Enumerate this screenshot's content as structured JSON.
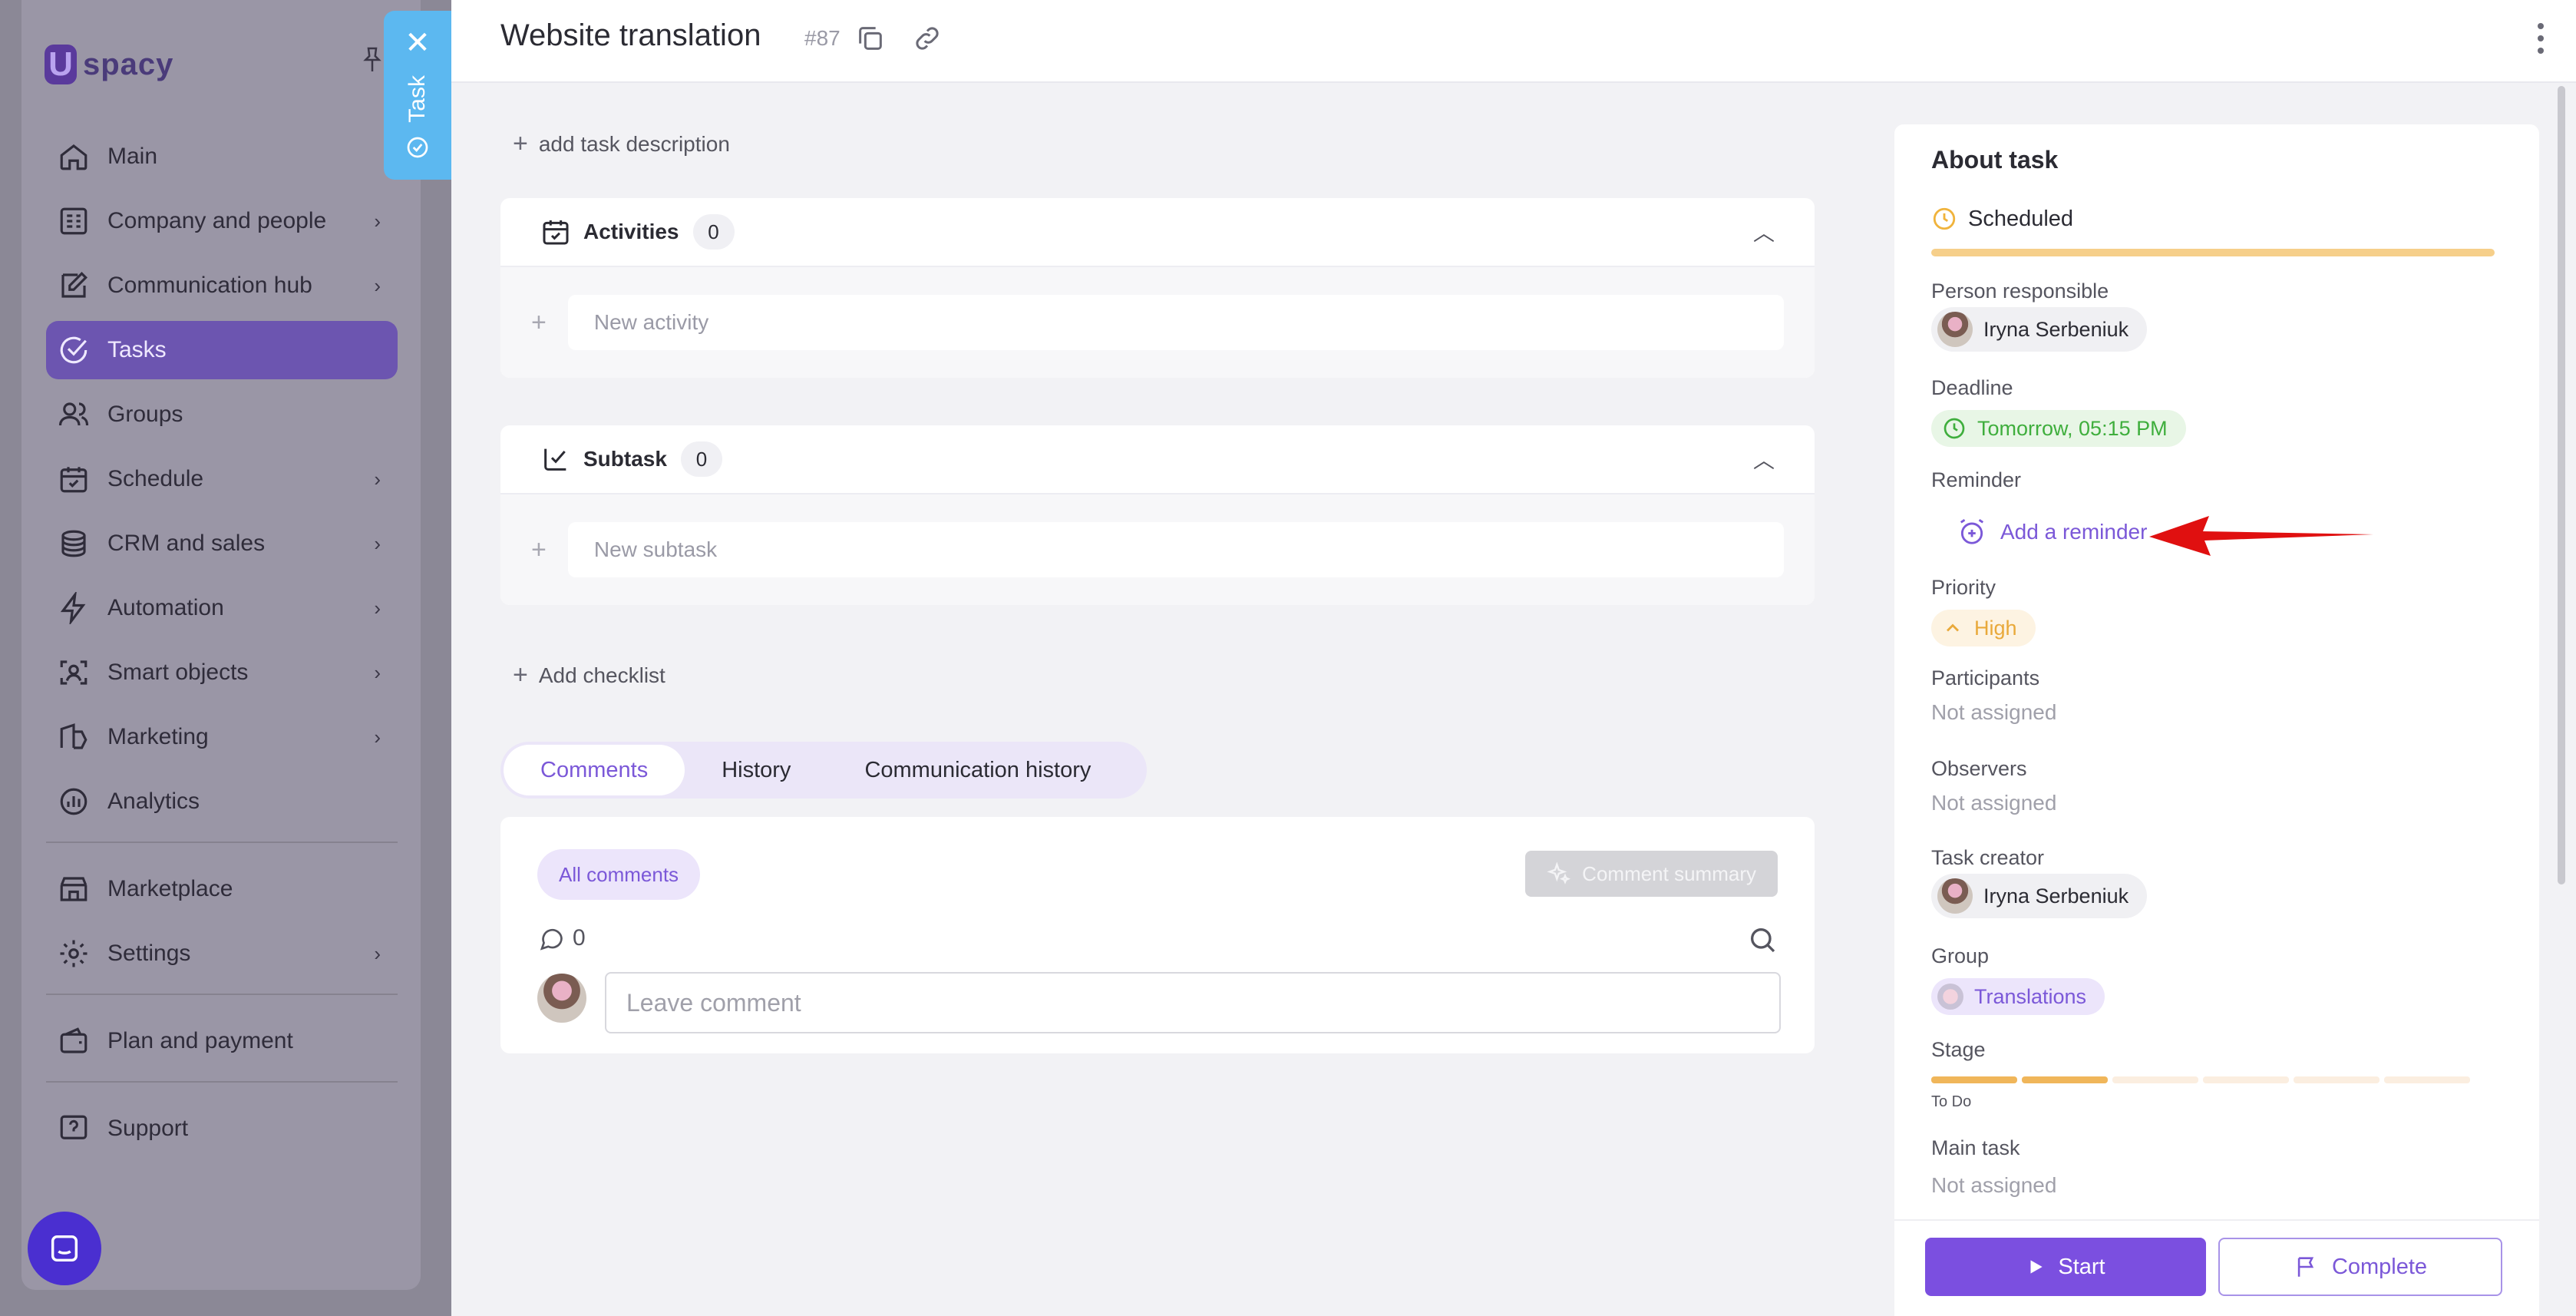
{
  "sidebar": {
    "logo_letter": "U",
    "logo_text": "spacy",
    "items": [
      {
        "label": "Main",
        "icon": "home-icon"
      },
      {
        "label": "Company and people",
        "icon": "building-icon",
        "chevron": "›"
      },
      {
        "label": "Communication hub",
        "icon": "edit-chat-icon",
        "chevron": "›"
      },
      {
        "label": "Tasks",
        "icon": "check-circle-icon"
      },
      {
        "label": "Groups",
        "icon": "users-icon"
      },
      {
        "label": "Schedule",
        "icon": "calendar-icon",
        "chevron": "›"
      },
      {
        "label": "CRM and sales",
        "icon": "coins-icon",
        "chevron": "›"
      },
      {
        "label": "Automation",
        "icon": "lightning-icon",
        "chevron": "›"
      },
      {
        "label": "Smart objects",
        "icon": "scan-face-icon",
        "chevron": "›"
      },
      {
        "label": "Marketing",
        "icon": "megaphone-icon",
        "chevron": "›"
      },
      {
        "label": "Analytics",
        "icon": "chart-icon"
      },
      {
        "label": "Marketplace",
        "icon": "store-icon"
      },
      {
        "label": "Settings",
        "icon": "gear-icon",
        "chevron": "›"
      },
      {
        "label": "Plan and payment",
        "icon": "wallet-icon"
      },
      {
        "label": "Support",
        "icon": "help-icon"
      }
    ]
  },
  "task_tab": {
    "close": "✕",
    "label": "Task"
  },
  "header": {
    "title": "Website translation",
    "task_number": "#87"
  },
  "main": {
    "add_description": "add task description",
    "activities": {
      "title": "Activities",
      "count": "0",
      "input_placeholder": "New activity"
    },
    "subtask": {
      "title": "Subtask",
      "count": "0",
      "input_placeholder": "New subtask"
    },
    "add_checklist": "Add checklist",
    "tabs": [
      {
        "label": "Comments",
        "active": true
      },
      {
        "label": "History",
        "active": false
      },
      {
        "label": "Communication history",
        "active": false
      }
    ],
    "comments": {
      "filter": "All comments",
      "summary_button": "Comment summary",
      "count": "0",
      "input_placeholder": "Leave comment"
    }
  },
  "about": {
    "title": "About task",
    "status": "Scheduled",
    "person_responsible": {
      "label": "Person responsible",
      "name": "Iryna Serbeniuk"
    },
    "deadline": {
      "label": "Deadline",
      "value": "Tomorrow, 05:15 PM"
    },
    "reminder": {
      "label": "Reminder",
      "action": "Add a reminder"
    },
    "priority": {
      "label": "Priority",
      "value": "High"
    },
    "participants": {
      "label": "Participants",
      "value": "Not assigned"
    },
    "observers": {
      "label": "Observers",
      "value": "Not assigned"
    },
    "task_creator": {
      "label": "Task creator",
      "name": "Iryna Serbeniuk"
    },
    "group": {
      "label": "Group",
      "value": "Translations"
    },
    "stage": {
      "label": "Stage",
      "caption": "To Do",
      "segments_total": 6,
      "segments_filled": 2
    },
    "main_task": {
      "label": "Main task",
      "value": "Not assigned"
    }
  },
  "footer": {
    "start": "Start",
    "complete": "Complete"
  },
  "colors": {
    "accent": "#7b4fe0",
    "scheduled": "#f6cf8a",
    "deadline": "#3fae3d",
    "priority_high": "#e9a93a",
    "annotation_arrow": "#e01010"
  }
}
